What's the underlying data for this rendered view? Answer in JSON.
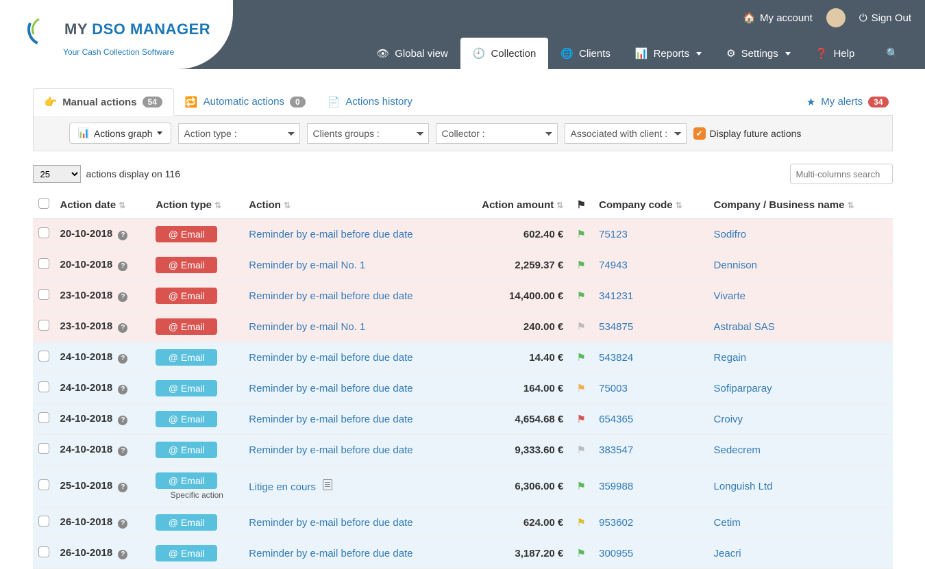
{
  "brand": {
    "my": "MY",
    "dso": " DSO ",
    "manager": "MANAGER",
    "tagline": "Your Cash Collection Software"
  },
  "topbar": {
    "account": "My account",
    "signout": "Sign Out"
  },
  "nav": {
    "global": "Global view",
    "collection": "Collection",
    "clients": "Clients",
    "reports": "Reports",
    "settings": "Settings",
    "help": "Help"
  },
  "subtabs": {
    "manual": "Manual actions",
    "manual_count": "54",
    "automatic": "Automatic actions",
    "automatic_count": "0",
    "history": "Actions history",
    "alerts": "My alerts",
    "alerts_count": "34"
  },
  "filters": {
    "graph_btn": "Actions graph",
    "action_type": "Action type :",
    "clients_groups": "Clients groups :",
    "collector": "Collector :",
    "associated": "Associated with client :",
    "future": "Display future actions"
  },
  "controls": {
    "page_size": "25",
    "display_suffix": "actions display on 116",
    "search_placeholder": "Multi-columns search"
  },
  "columns": {
    "date": "Action date",
    "type": "Action type",
    "action": "Action",
    "amount": "Action amount",
    "code": "Company code",
    "company": "Company / Business name"
  },
  "email_label": "@ Email",
  "specific_label": "Specific action",
  "rows": [
    {
      "date": "20-10-2018",
      "past": true,
      "chip": "red",
      "action": "Reminder by e-mail before due date",
      "amount": "602.40 €",
      "flag": "green",
      "code": "75123",
      "company": "Sodifro"
    },
    {
      "date": "20-10-2018",
      "past": true,
      "chip": "red",
      "action": "Reminder by e-mail No. 1",
      "amount": "2,259.37 €",
      "flag": "green",
      "code": "74943",
      "company": "Dennison"
    },
    {
      "date": "23-10-2018",
      "past": true,
      "chip": "red",
      "action": "Reminder by e-mail before due date",
      "amount": "14,400.00 €",
      "flag": "green",
      "code": "341231",
      "company": "Vivarte"
    },
    {
      "date": "23-10-2018",
      "past": true,
      "chip": "red",
      "action": "Reminder by e-mail No. 1",
      "amount": "240.00 €",
      "flag": "grey",
      "code": "534875",
      "company": "Astrabal SAS"
    },
    {
      "date": "24-10-2018",
      "past": false,
      "chip": "blue",
      "action": "Reminder by e-mail before due date",
      "amount": "14.40 €",
      "flag": "green",
      "code": "543824",
      "company": "Regain"
    },
    {
      "date": "24-10-2018",
      "past": false,
      "chip": "blue",
      "action": "Reminder by e-mail before due date",
      "amount": "164.00 €",
      "flag": "orange",
      "code": "75003",
      "company": "Sofiparparay"
    },
    {
      "date": "24-10-2018",
      "past": false,
      "chip": "blue",
      "action": "Reminder by e-mail before due date",
      "amount": "4,654.68 €",
      "flag": "red",
      "code": "654365",
      "company": "Croivy"
    },
    {
      "date": "24-10-2018",
      "past": false,
      "chip": "blue",
      "action": "Reminder by e-mail before due date",
      "amount": "9,333.60 €",
      "flag": "grey",
      "code": "383547",
      "company": "Sedecrem"
    },
    {
      "date": "25-10-2018",
      "past": false,
      "chip": "blue",
      "action": "Litige en cours",
      "amount": "6,306.00 €",
      "flag": "green",
      "code": "359988",
      "company": "Longuish Ltd",
      "doc": true,
      "specific": true
    },
    {
      "date": "26-10-2018",
      "past": false,
      "chip": "blue",
      "action": "Reminder by e-mail before due date",
      "amount": "624.00 €",
      "flag": "yellow",
      "code": "953602",
      "company": "Cetim"
    },
    {
      "date": "26-10-2018",
      "past": false,
      "chip": "blue",
      "action": "Reminder by e-mail before due date",
      "amount": "3,187.20 €",
      "flag": "green",
      "code": "300955",
      "company": "Jeacri"
    }
  ]
}
